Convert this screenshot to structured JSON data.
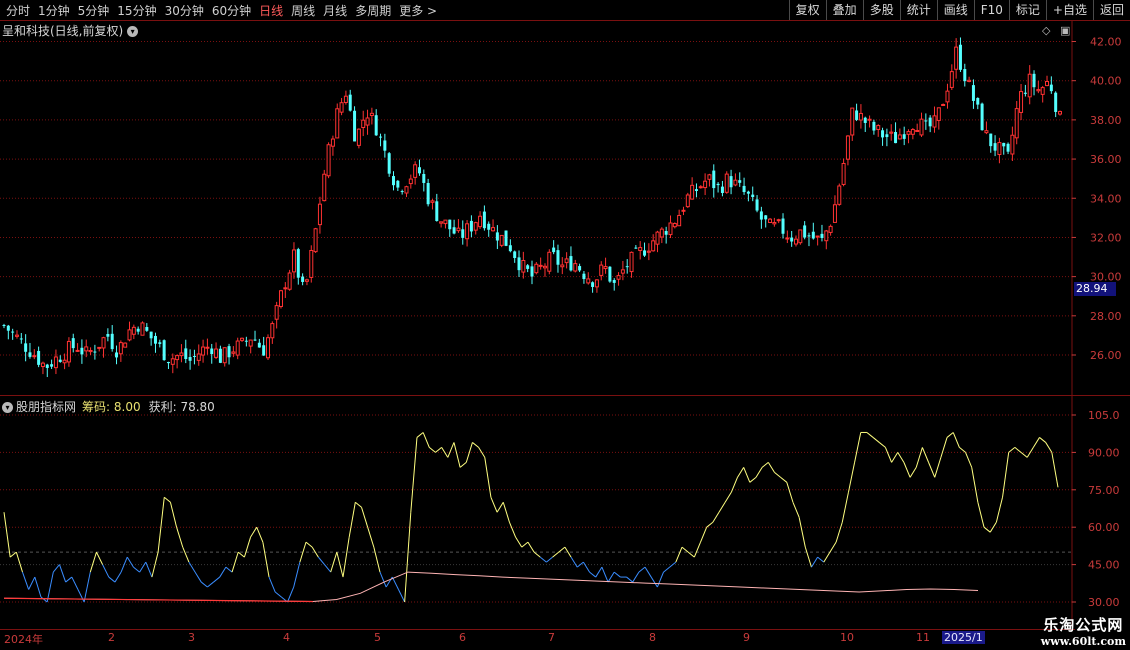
{
  "toolbar": {
    "periods": [
      "分时",
      "1分钟",
      "5分钟",
      "15分钟",
      "30分钟",
      "60分钟",
      "日线",
      "周线",
      "月线",
      "多周期",
      "更多 >"
    ],
    "active_period": "日线",
    "actions": [
      "复权",
      "叠加",
      "多股",
      "统计",
      "画线",
      "F10",
      "+自选",
      "返回"
    ],
    "marker_label": "标记"
  },
  "stock": {
    "title": "呈和科技(日线,前复权)",
    "last_price": "28.94"
  },
  "indicator": {
    "name": "股朋指标网",
    "chip_label": "筹码: 8.00",
    "profit_label": "获利: 78.80"
  },
  "price_axis": [
    "42.00",
    "40.00",
    "38.00",
    "36.00",
    "34.00",
    "32.00",
    "30.00",
    "28.00",
    "26.00"
  ],
  "ind_axis": [
    "105.0",
    "90.00",
    "75.00",
    "60.00",
    "45.00",
    "30.00"
  ],
  "date_axis": [
    {
      "label": "2024年",
      "x": 4
    },
    {
      "label": "2",
      "x": 108
    },
    {
      "label": "3",
      "x": 188
    },
    {
      "label": "4",
      "x": 283
    },
    {
      "label": "5",
      "x": 374
    },
    {
      "label": "6",
      "x": 459
    },
    {
      "label": "7",
      "x": 548
    },
    {
      "label": "8",
      "x": 649
    },
    {
      "label": "9",
      "x": 743
    },
    {
      "label": "10",
      "x": 840
    },
    {
      "label": "11",
      "x": 916
    },
    {
      "label": "2025/1",
      "x": 942,
      "highlight": true
    }
  ],
  "watermark": {
    "line1": "乐淘公式网",
    "line2": "www.60lt.com"
  },
  "colors": {
    "up": "#ff3232",
    "down": "#54ffff",
    "grid": "#7a1010",
    "axis": "#c93b3b",
    "profit": "#ffff80",
    "profit_low": "#3a8dff",
    "cost": "#ffb4b4"
  },
  "chart_data": [
    {
      "type": "candlestick",
      "title": "呈和科技(日线,前复权)",
      "ylim": [
        24.5,
        42.5
      ],
      "y_ticks": [
        42,
        40,
        38,
        36,
        34,
        32,
        30,
        28,
        26
      ],
      "last_price": 28.94,
      "x_labels": [
        "2024年",
        "2",
        "3",
        "4",
        "5",
        "6",
        "7",
        "8",
        "9",
        "10",
        "11",
        "2025/1"
      ],
      "close_path": [
        27.5,
        27.0,
        26.5,
        26.0,
        25.4,
        25.8,
        26.2,
        26.5,
        26.0,
        26.5,
        27.0,
        26.2,
        27.2,
        27.6,
        27.0,
        26.4,
        25.8,
        26.0,
        25.7,
        26.2,
        26.5,
        25.8,
        26.3,
        26.5,
        27.0,
        26.2,
        27.5,
        29.5,
        31.0,
        29.0,
        32.0,
        35.5,
        38.0,
        39.5,
        37.0,
        38.5,
        37.6,
        36.0,
        34.5,
        35.0,
        35.5,
        34.0,
        33.0,
        32.5,
        32.0,
        32.5,
        33.2,
        32.5,
        32.0,
        31.5,
        30.5,
        30.0,
        30.5,
        31.0,
        30.5,
        30.8,
        30.2,
        29.8,
        30.5,
        29.5,
        30.5,
        31.0,
        31.5,
        32.0,
        32.5,
        33.0,
        34.0,
        34.5,
        35.0,
        34.5,
        35.0,
        34.5,
        34.0,
        33.0,
        32.5,
        32.5,
        32.0,
        32.3,
        32.0,
        31.8,
        33.0,
        35.5,
        38.5,
        38.0,
        37.5,
        37.2,
        37.0,
        37.5,
        38.0,
        37.5,
        37.8,
        39.5,
        41.5,
        40.0,
        38.5,
        37.0,
        36.5,
        36.0,
        39.0,
        40.0,
        39.5,
        40.0,
        38.0
      ]
    },
    {
      "type": "line",
      "title": "股朋指标网",
      "ylim": [
        27,
        110
      ],
      "y_ticks": [
        105,
        90,
        75,
        60,
        45,
        30
      ],
      "annotations": [
        "筹码: 8.00",
        "获利: 78.80"
      ],
      "series": [
        {
          "values": [
            66,
            48,
            50,
            42,
            35,
            40,
            32,
            30,
            42,
            45,
            38,
            40,
            35,
            30,
            42,
            50,
            45,
            40,
            38,
            42,
            48,
            44,
            42,
            46,
            40,
            50,
            72,
            70,
            60,
            52,
            46,
            42,
            38,
            36,
            38,
            40,
            44,
            42,
            50,
            48,
            56,
            60,
            54,
            40,
            34,
            32,
            30,
            36,
            46,
            54,
            52,
            48,
            45,
            42,
            50,
            40,
            56,
            70,
            68,
            60,
            52,
            42,
            36,
            40,
            35,
            30,
            66,
            96,
            98,
            92,
            90,
            92,
            88,
            94,
            84,
            86,
            94,
            92,
            88,
            72,
            66,
            70,
            62,
            56,
            52,
            54,
            50,
            48,
            46,
            48,
            50,
            52,
            48,
            44,
            46,
            42,
            40,
            44,
            38,
            42,
            40,
            40,
            38,
            42,
            44,
            40,
            36,
            42,
            44,
            46,
            52,
            50,
            48,
            54,
            60,
            62,
            66,
            70,
            74,
            80,
            84,
            78,
            80,
            84,
            86,
            82,
            80,
            78,
            70,
            64,
            52,
            44,
            48,
            46,
            50,
            54,
            62,
            74,
            86,
            98,
            98,
            96,
            94,
            92,
            86,
            90,
            86,
            80,
            84,
            92,
            86,
            80,
            88,
            96,
            98,
            92,
            90,
            84,
            70,
            60,
            58,
            62,
            72,
            90,
            92,
            90,
            88,
            92,
            96,
            94,
            90,
            76
          ]
        },
        {
          "values": [
            31.5,
            31.4,
            31.3,
            31.2,
            31.1,
            31.0,
            30.9,
            30.8,
            30.7,
            30.6,
            30.5,
            30.4,
            30.3,
            30.2,
            31.0,
            33.5,
            38.0,
            42.0,
            41.5,
            41.0,
            40.5,
            40.0,
            39.6,
            39.2,
            38.8,
            38.4,
            38.0,
            37.6,
            37.2,
            36.8,
            36.4,
            36.0,
            35.6,
            35.2,
            34.8,
            34.4,
            34.0,
            34.5,
            35.0,
            35.2,
            35.0,
            34.6
          ]
        }
      ]
    }
  ]
}
